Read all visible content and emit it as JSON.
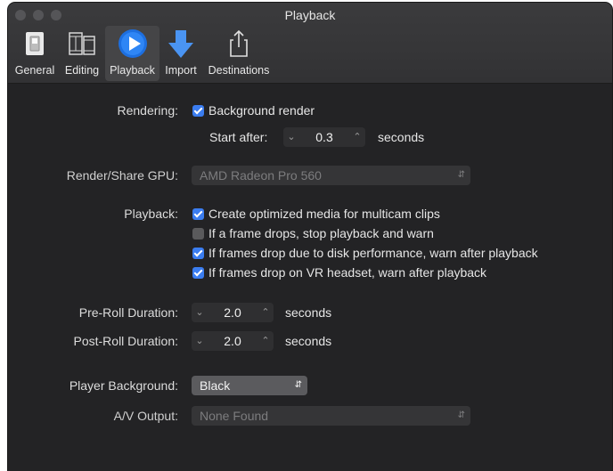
{
  "window": {
    "title": "Playback"
  },
  "toolbar": {
    "items": [
      {
        "label": "General",
        "icon": "general-switch-icon"
      },
      {
        "label": "Editing",
        "icon": "film-strip-icon"
      },
      {
        "label": "Playback",
        "icon": "play-circle-icon"
      },
      {
        "label": "Import",
        "icon": "down-arrow-icon"
      },
      {
        "label": "Destinations",
        "icon": "share-icon"
      }
    ],
    "selected": "Playback"
  },
  "rendering": {
    "label": "Rendering:",
    "background_render": {
      "label": "Background render",
      "checked": true
    },
    "start_after": {
      "label": "Start after:",
      "value": "0.3",
      "unit": "seconds"
    }
  },
  "gpu": {
    "label": "Render/Share GPU:",
    "value": "AMD Radeon Pro 560",
    "enabled": false
  },
  "playback": {
    "label": "Playback:",
    "options": [
      {
        "label": "Create optimized media for multicam clips",
        "checked": true
      },
      {
        "label": "If a frame drops, stop playback and warn",
        "checked": false
      },
      {
        "label": "If frames drop due to disk performance, warn after playback",
        "checked": true
      },
      {
        "label": "If frames drop on VR headset, warn after playback",
        "checked": true
      }
    ]
  },
  "preroll": {
    "label": "Pre-Roll Duration:",
    "value": "2.0",
    "unit": "seconds"
  },
  "postroll": {
    "label": "Post-Roll Duration:",
    "value": "2.0",
    "unit": "seconds"
  },
  "player_background": {
    "label": "Player Background:",
    "value": "Black"
  },
  "av_output": {
    "label": "A/V Output:",
    "value": "None Found",
    "enabled": false
  },
  "colors": {
    "accent": "#3b7df0",
    "window_bg": "#232325",
    "toolbar_bg": "#323234"
  }
}
